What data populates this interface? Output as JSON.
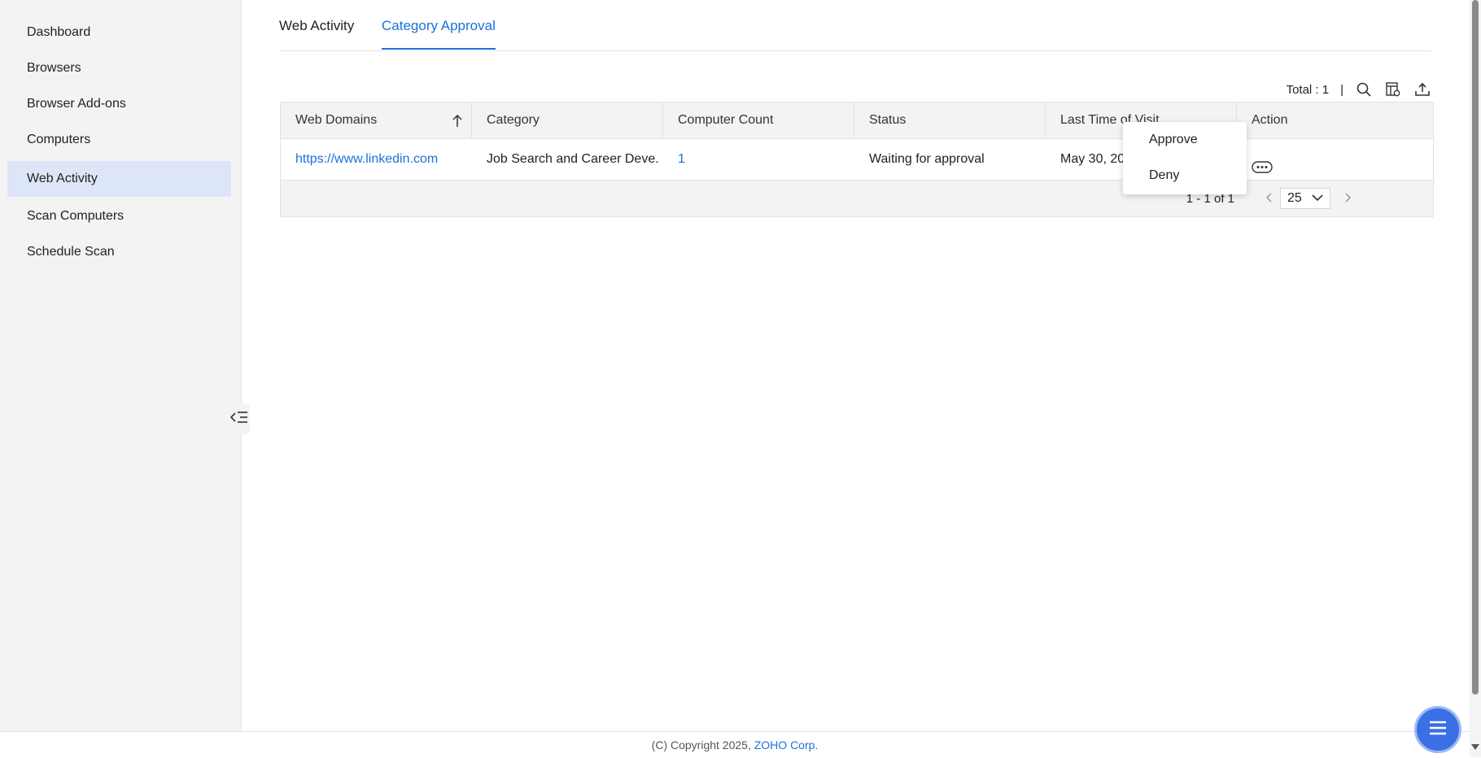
{
  "sidebar": {
    "items": [
      {
        "label": "Dashboard"
      },
      {
        "label": "Browsers"
      },
      {
        "label": "Browser Add-ons"
      },
      {
        "label": "Computers"
      },
      {
        "label": "Web Activity"
      },
      {
        "label": "Scan Computers"
      },
      {
        "label": "Schedule Scan"
      }
    ],
    "active": "Web Activity",
    "collapse_icon": "collapse-sidebar-icon"
  },
  "tabs": [
    {
      "label": "Web Activity"
    },
    {
      "label": "Category Approval"
    }
  ],
  "active_tab": "Category Approval",
  "toolbar": {
    "total_text": "Total : 1",
    "separator": "|",
    "icons": [
      "search-icon",
      "column-settings-icon",
      "export-icon"
    ]
  },
  "table": {
    "columns": [
      "Web Domains",
      "Category",
      "Computer Count",
      "Status",
      "Last Time of Visit",
      "Action"
    ],
    "sort_icon": "sort-ascending-icon",
    "rows": [
      {
        "domain": "https://www.linkedin.com",
        "category": "Job Search and Career Deve...",
        "count": "1",
        "status": "Waiting for approval",
        "last_visit": "May 30, 20",
        "action_icon": "more-options-icon"
      }
    ]
  },
  "pagination": {
    "range": "1 - 1 of 1",
    "page_size": "25"
  },
  "action_menu": {
    "items": [
      "Approve",
      "Deny"
    ]
  },
  "footer": {
    "copyright": "(C) Copyright 2025,",
    "company": "ZOHO Corp."
  },
  "colors": {
    "accent": "#1a73d9",
    "sidebar_bg": "#f3f3f3",
    "sidebar_active": "#dde5f8",
    "fab": "#3a6fe6"
  }
}
